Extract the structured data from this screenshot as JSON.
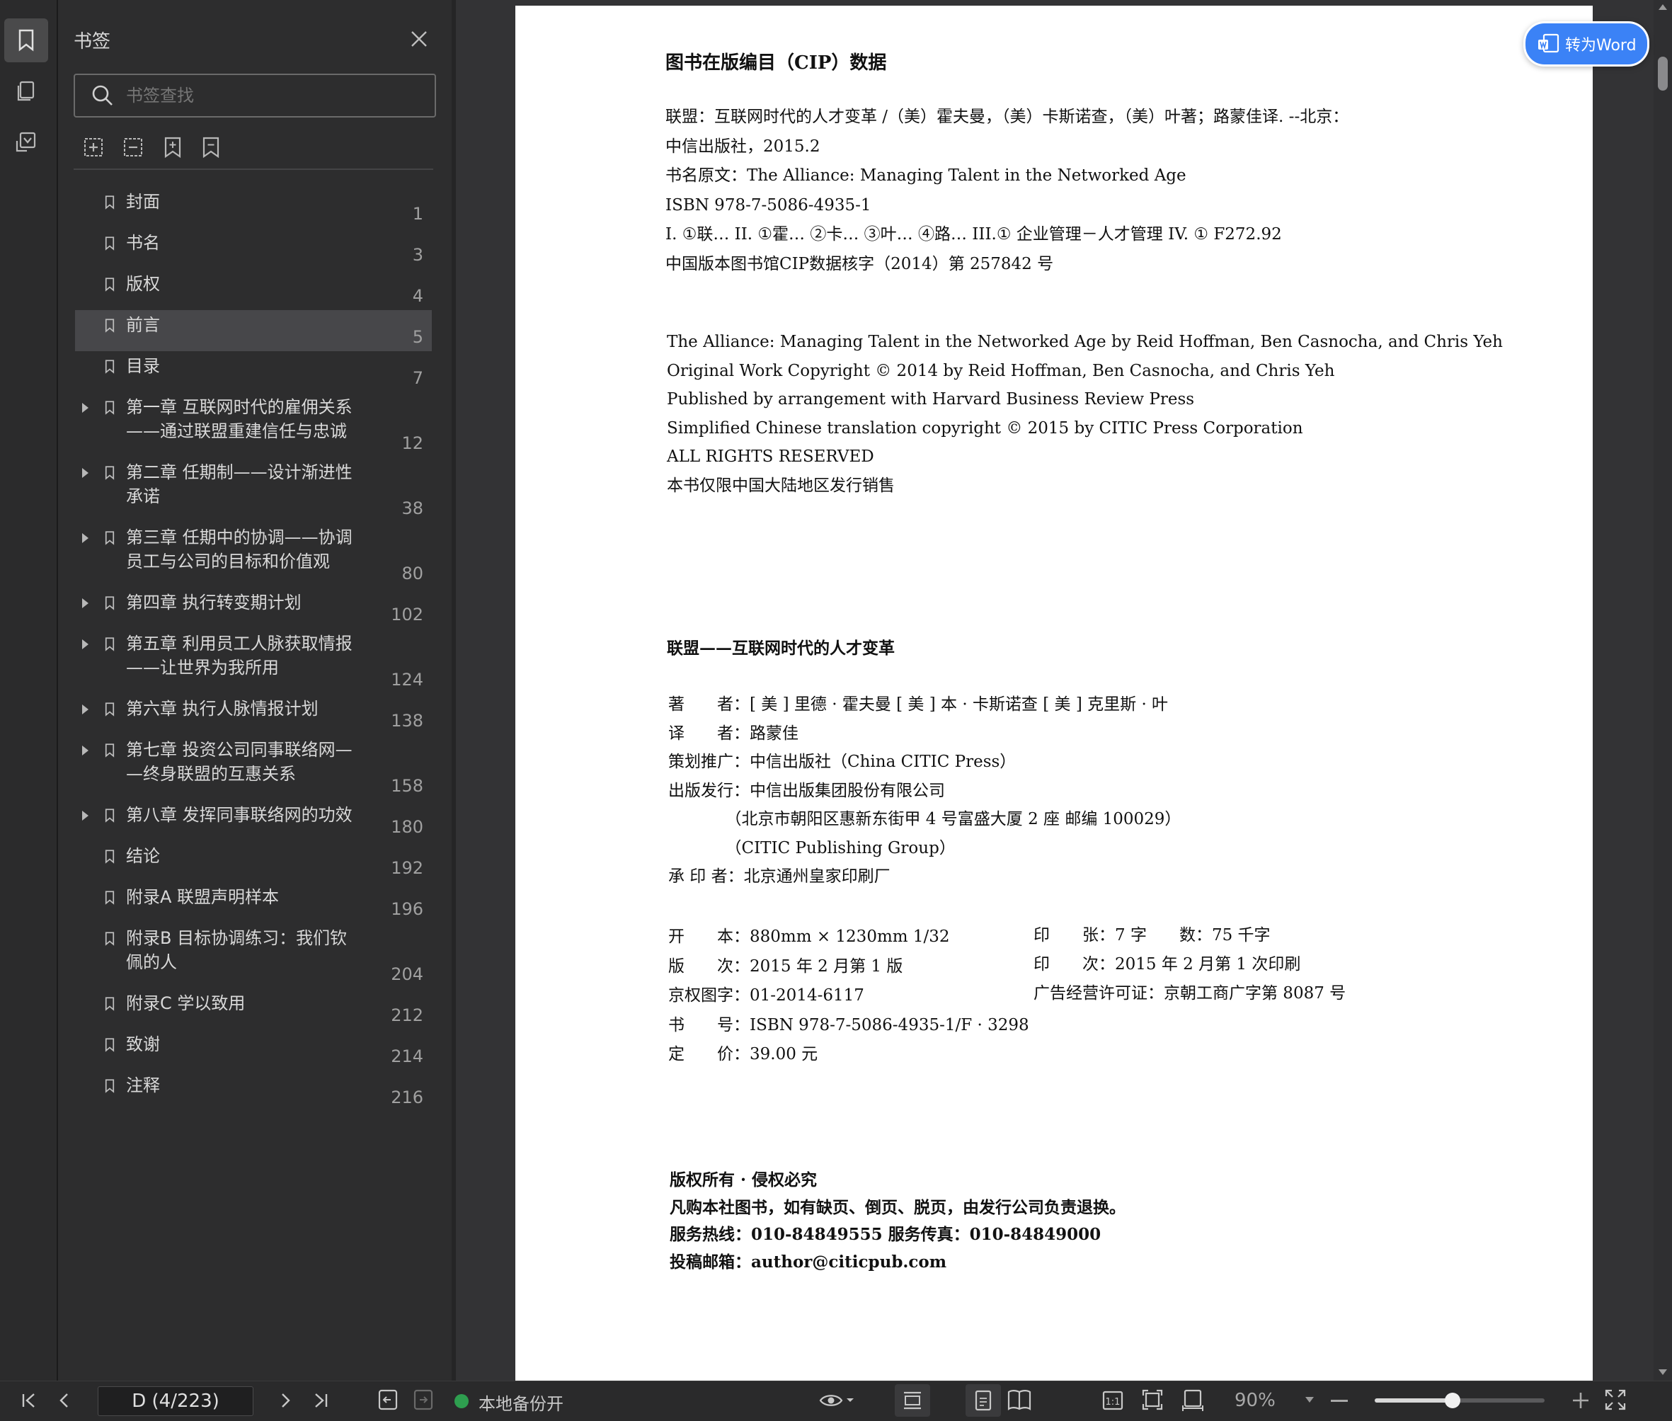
{
  "sidebar": {
    "title": "书签",
    "search_placeholder": "书签查找",
    "items": [
      {
        "label": "封面",
        "page": "1",
        "expandable": false
      },
      {
        "label": "书名",
        "page": "3",
        "expandable": false
      },
      {
        "label": "版权",
        "page": "4",
        "expandable": false
      },
      {
        "label": "前言",
        "page": "5",
        "expandable": false,
        "selected": true
      },
      {
        "label": "目录",
        "page": "7",
        "expandable": false
      },
      {
        "label": "第一章 互联网时代的雇佣关系\n——通过联盟重建信任与忠诚",
        "page": "12",
        "expandable": true
      },
      {
        "label": "第二章 任期制——设计渐进性\n承诺",
        "page": "38",
        "expandable": true
      },
      {
        "label": "第三章 任期中的协调——协调\n员工与公司的目标和价值观",
        "page": "80",
        "expandable": true
      },
      {
        "label": "第四章 执行转变期计划",
        "page": "102",
        "expandable": true
      },
      {
        "label": "第五章 利用员工人脉获取情报\n——让世界为我所用",
        "page": "124",
        "expandable": true
      },
      {
        "label": "第六章 执行人脉情报计划",
        "page": "138",
        "expandable": true
      },
      {
        "label": "第七章 投资公司同事联络网—\n—终身联盟的互惠关系",
        "page": "158",
        "expandable": true
      },
      {
        "label": "第八章 发挥同事联络网的功效",
        "page": "180",
        "expandable": true
      },
      {
        "label": "结论",
        "page": "192",
        "expandable": false
      },
      {
        "label": "附录A 联盟声明样本",
        "page": "196",
        "expandable": false
      },
      {
        "label": "附录B 目标协调练习：我们钦\n佩的人",
        "page": "204",
        "expandable": false
      },
      {
        "label": "附录C 学以致用",
        "page": "212",
        "expandable": false
      },
      {
        "label": "致谢",
        "page": "214",
        "expandable": false
      },
      {
        "label": "注释",
        "page": "216",
        "expandable": false
      }
    ]
  },
  "to_word_button": "转为Word",
  "document": {
    "cip_title": "图书在版编目（CIP）数据",
    "cip_lines": [
      "联盟：互联网时代的人才变革 /（美）霍夫曼，（美）卡斯诺查，（美）叶著；路蒙佳译. --北京：",
      "中信出版社，2015.2",
      "书名原文：The Alliance: Managing Talent in the Networked Age",
      "ISBN 978-7-5086-4935-1",
      "I. ①联…   II. ①霍…   ②卡…   ③叶…   ④路…   III.① 企业管理－人才管理   IV. ① F272.92",
      "中国版本图书馆CIP数据核字（2014）第 257842 号"
    ],
    "copyright_lines": [
      "The Alliance: Managing Talent in the Networked Age by Reid Hoffman, Ben Casnocha, and Chris Yeh",
      "Original Work Copyright © 2014 by Reid Hoffman, Ben Casnocha, and Chris Yeh",
      "Published by arrangement with Harvard Business Review Press",
      "Simplified Chinese translation copyright  © 2015 by CITIC Press Corporation",
      "ALL RIGHTS RESERVED",
      "本书仅限中国大陆地区发行销售"
    ],
    "book_title": "联盟——互联网时代的人才变革",
    "credits": [
      "著　　者：[ 美 ] 里德 · 霍夫曼  [ 美 ] 本 · 卡斯诺查  [ 美 ] 克里斯 · 叶",
      "译　　者：路蒙佳",
      "策划推广：中信出版社（China CITIC Press）",
      "出版发行：中信出版集团股份有限公司",
      "　　　　（北京市朝阳区惠新东街甲 4 号富盛大厦 2 座    邮编    100029）",
      "　　　　（CITIC Publishing Group）",
      "承 印 者：北京通州皇家印刷厂"
    ],
    "specs_left": [
      "开　　本：880mm × 1230mm    1/32",
      "版　　次：2015 年 2 月第 1 版",
      "京权图字：01-2014-6117",
      "书　　号：ISBN 978-7-5086-4935-1/F · 3298",
      "定　　价：39.00 元"
    ],
    "specs_right": [
      "印　　张：7                                字　　数：75 千字",
      "印　　次：2015 年 2 月第 1 次印刷",
      "广告经营许可证：京朝工商广字第 8087 号"
    ],
    "rights_lines": [
      "版权所有 · 侵权必究",
      "凡购本社图书，如有缺页、倒页、脱页，由发行公司负责退换。",
      "服务热线：010-84849555        服务传真：010-84849000",
      "投稿邮箱：author@citicpub.com"
    ]
  },
  "statusbar": {
    "page_indicator": "D (4/223)",
    "backup_status": "本地备份开",
    "zoom": "90%",
    "zoom_slider_fraction": 0.46
  }
}
